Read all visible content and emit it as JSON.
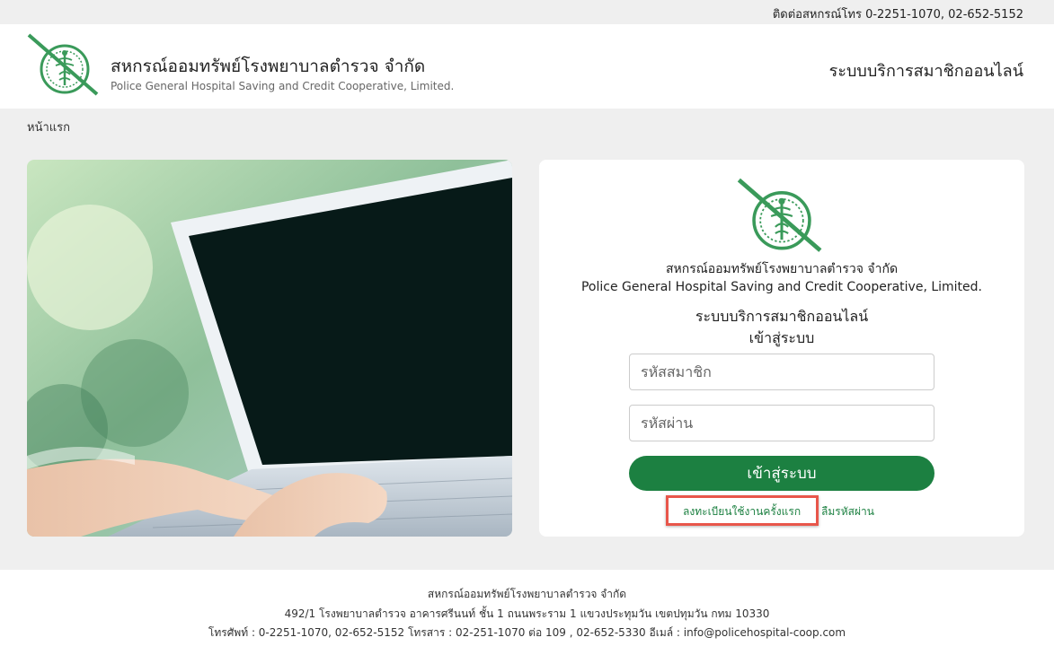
{
  "topbar": {
    "contact": "ติดต่อสหกรณ์โทร 0-2251-1070, 02-652-5152"
  },
  "header": {
    "org_name_th": "สหกรณ์ออมทรัพย์โรงพยาบาลตำรวจ จำกัด",
    "org_name_en": "Police General Hospital Saving and Credit Cooperative, Limited.",
    "system_title": "ระบบบริการสมาชิกออนไลน์"
  },
  "breadcrumb": {
    "home": "หน้าแรก"
  },
  "login": {
    "org_name_th": "สหกรณ์ออมทรัพย์โรงพยาบาลตำรวจ จำกัด",
    "org_name_en": "Police General Hospital Saving and Credit Cooperative, Limited.",
    "system_title": "ระบบบริการสมาชิกออนไลน์",
    "heading": "เข้าสู่ระบบ",
    "member_placeholder": "รหัสสมาชิก",
    "password_placeholder": "รหัสผ่าน",
    "submit_label": "เข้าสู่ระบบ",
    "register_label": "ลงทะเบียนใช้งานครั้งแรก",
    "forgot_label": "ลืมรหัสผ่าน"
  },
  "footer": {
    "org_name": "สหกรณ์ออมทรัพย์โรงพยาบาลตำรวจ จำกัด",
    "address": "492/1 โรงพยาบาลตำรวจ อาคารศรีนนท์ ชั้น 1 ถนนพระราม 1 แขวงประทุมวัน เขตปทุมวัน กทม 10330",
    "contact": "โทรศัพท์ : 0-2251-1070, 02-652-5152 โทรสาร : 02-251-1070 ต่อ 109 , 02-652-5330 อีเมล์ : info@policehospital-coop.com"
  },
  "colors": {
    "brand_green": "#1c8041",
    "highlight_red": "#e8564b"
  },
  "icons": {
    "logo": "police-hospital-coop-logo",
    "hero": "laptop-typing-photo"
  }
}
